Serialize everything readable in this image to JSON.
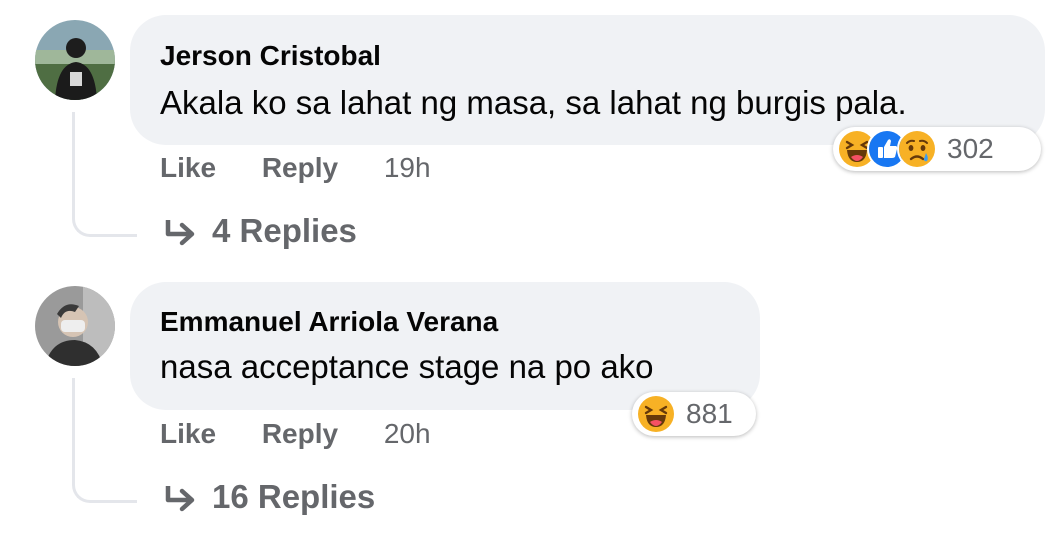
{
  "comments": [
    {
      "author": "Jerson Cristobal",
      "text": "Akala ko sa lahat ng masa, sa lahat ng burgis pala.",
      "actions": {
        "like": "Like",
        "reply": "Reply",
        "time": "19h"
      },
      "reactions": {
        "icons": [
          "haha-icon",
          "like-icon",
          "sad-icon"
        ],
        "count": "302"
      },
      "replies_label": "4 Replies"
    },
    {
      "author": "Emmanuel Arriola Verana",
      "text": "nasa acceptance stage na po ako",
      "actions": {
        "like": "Like",
        "reply": "Reply",
        "time": "20h"
      },
      "reactions": {
        "icons": [
          "haha-icon"
        ],
        "count": "881"
      },
      "replies_label": "16 Replies"
    }
  ],
  "colors": {
    "bubble": "#f0f2f5",
    "secondary_text": "#65676b",
    "thread_line": "#e4e6eb",
    "like_blue": "#1877f2",
    "emoji_yellow": "#f7b125"
  }
}
